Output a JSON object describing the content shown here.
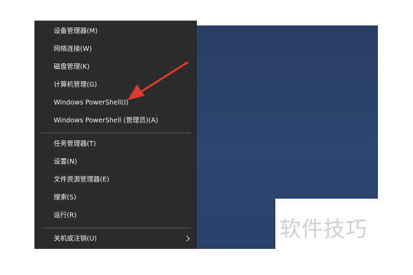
{
  "winx_menu": {
    "items": [
      "设备管理器(M)",
      "网络连接(W)",
      "磁盘管理(K)",
      "计算机管理(G)",
      "Windows PowerShell(I)",
      "Windows PowerShell (管理员)(A)",
      "任务管理器(T)",
      "设置(N)",
      "文件资源管理器(E)",
      "搜索(S)",
      "运行(R)",
      "关机或注销(U)"
    ],
    "submenu_icon": "chevron-right-icon"
  },
  "annotation": {
    "arrow_icon": "red-arrow-icon",
    "color": "#e03a2f"
  },
  "watermark": {
    "text": "软件技巧"
  },
  "colors": {
    "menu_background": "#2b2b2b",
    "menu_text": "#f2f2f2",
    "desktop_background": "#2b436b"
  }
}
